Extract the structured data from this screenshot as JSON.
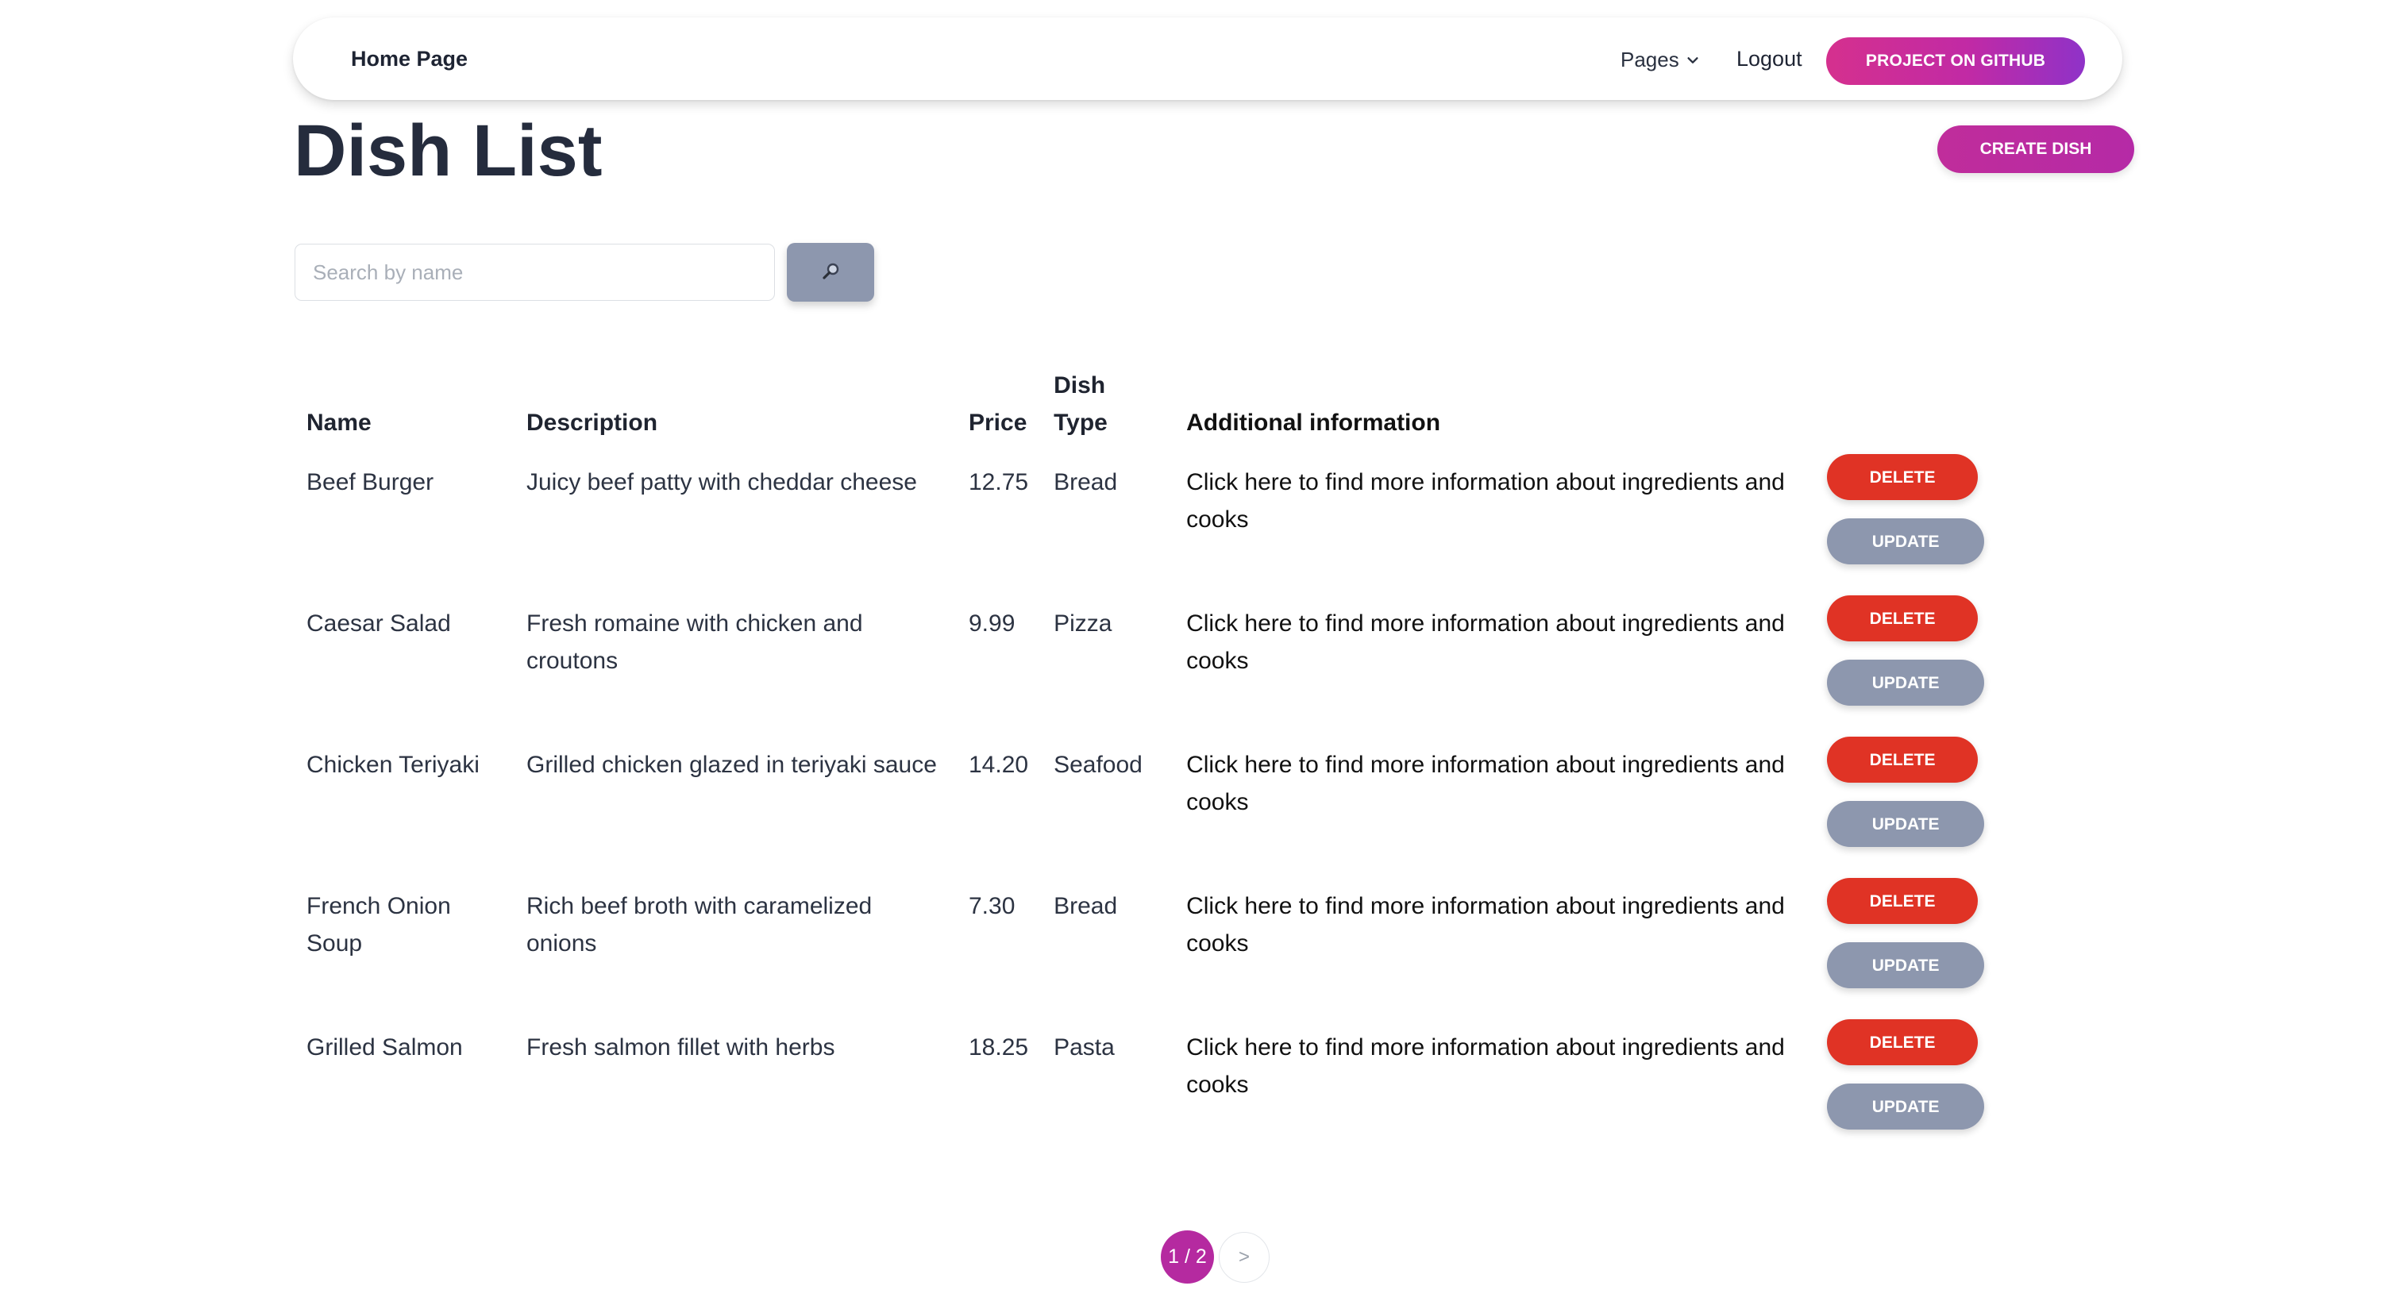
{
  "navbar": {
    "home": "Home Page",
    "pages": "Pages",
    "logout": "Logout",
    "github": "PROJECT ON GITHUB"
  },
  "page": {
    "title": "Dish List",
    "create_button": "CREATE DISH"
  },
  "search": {
    "placeholder": "Search by name",
    "value": "",
    "button_icon": "magnifier-icon"
  },
  "table": {
    "headers": {
      "name": "Name",
      "description": "Description",
      "price": "Price",
      "dish_type": "Dish Type",
      "additional": "Additional information"
    },
    "rows": [
      {
        "name": "Beef Burger",
        "description": "Juicy beef patty with cheddar cheese",
        "price": "12.75",
        "dish_type": "Bread",
        "additional": "Click here to find more information about ingredients and cooks",
        "delete": "DELETE",
        "update": "UPDATE"
      },
      {
        "name": "Caesar Salad",
        "description": "Fresh romaine with chicken and croutons",
        "price": "9.99",
        "dish_type": "Pizza",
        "additional": "Click here to find more information about ingredients and cooks",
        "delete": "DELETE",
        "update": "UPDATE"
      },
      {
        "name": "Chicken Teriyaki",
        "description": "Grilled chicken glazed in teriyaki sauce",
        "price": "14.20",
        "dish_type": "Seafood",
        "additional": "Click here to find more information about ingredients and cooks",
        "delete": "DELETE",
        "update": "UPDATE"
      },
      {
        "name": "French Onion Soup",
        "description": "Rich beef broth with caramelized onions",
        "price": "7.30",
        "dish_type": "Bread",
        "additional": "Click here to find more information about ingredients and cooks",
        "delete": "DELETE",
        "update": "UPDATE"
      },
      {
        "name": "Grilled Salmon",
        "description": "Fresh salmon fillet with herbs",
        "price": "18.25",
        "dish_type": "Pasta",
        "additional": "Click here to find more information about ingredients and cooks",
        "delete": "DELETE",
        "update": "UPDATE"
      }
    ]
  },
  "pagination": {
    "current": "1 / 2",
    "next": ">"
  },
  "colors": {
    "accent": "#b52aa0",
    "github_gradient_start": "#d5308e",
    "github_gradient_end": "#8f32c8",
    "delete": "#e03325",
    "update": "#8d97ae",
    "title": "#252c3d"
  }
}
